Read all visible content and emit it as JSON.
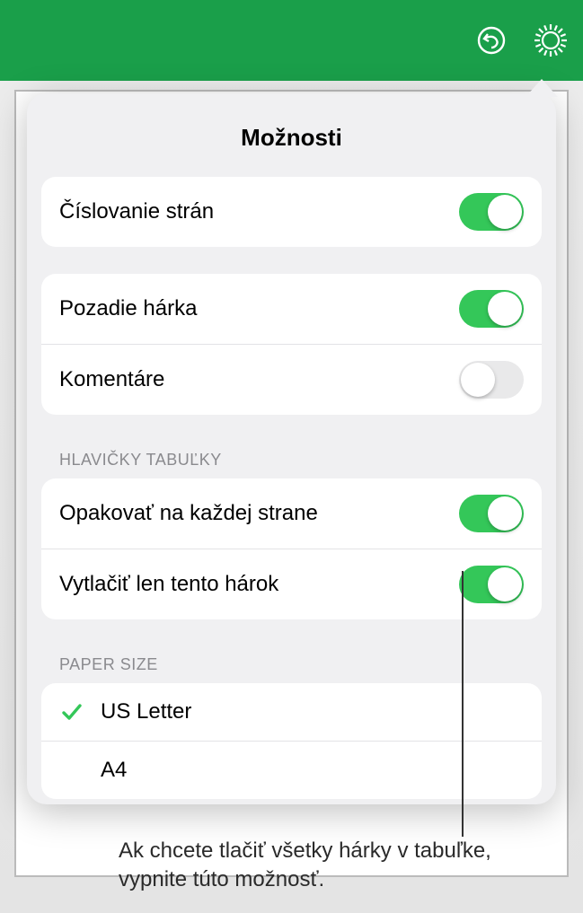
{
  "popover": {
    "title": "Možnosti",
    "group1": {
      "page_numbering": {
        "label": "Číslovanie strán",
        "on": true
      }
    },
    "group2": {
      "sheet_background": {
        "label": "Pozadie hárka",
        "on": true
      },
      "comments": {
        "label": "Komentáre",
        "on": false
      }
    },
    "headers_section_label": "HLAVIČKY TABUĽKY",
    "group3": {
      "repeat_each_page": {
        "label": "Opakovať na každej strane",
        "on": true
      },
      "print_only_this_sheet": {
        "label": "Vytlačiť len tento hárok",
        "on": true
      }
    },
    "paper_section_label": "PAPER SIZE",
    "paper": {
      "us_letter": {
        "label": "US Letter",
        "selected": true
      },
      "a4": {
        "label": "A4",
        "selected": false
      }
    }
  },
  "callout": {
    "text": "Ak chcete tlačiť všetky hárky v tabuľke, vypnite túto možnosť."
  },
  "colors": {
    "topbar": "#1a9f4a",
    "toggle_on": "#34c759"
  }
}
